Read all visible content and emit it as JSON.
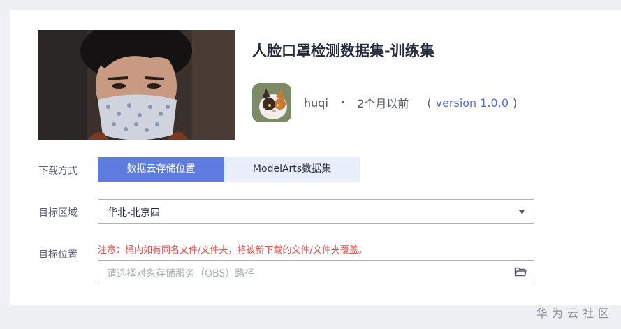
{
  "dataset": {
    "title": "人脸口罩检测数据集-训练集",
    "author": "huqi",
    "dot": "•",
    "time": "2个月以前",
    "version_open": "(",
    "version": "version 1.0.0",
    "version_close": ")"
  },
  "form": {
    "download_label": "下载方式",
    "tabs": [
      "数据云存储位置",
      "ModelArts数据集"
    ],
    "region_label": "目标区域",
    "region_value": "华北-北京四",
    "location_label": "目标位置",
    "warning": "注意：桶内如有同名文件/文件夹，将被新下载的文件/文件夹覆盖。",
    "path_placeholder": "请选择对象存储服务（OBS）路径"
  },
  "watermark": "华为云社区",
  "colors": {
    "primary": "#5e7ce0",
    "warning": "#de504e",
    "link": "#526ecc"
  },
  "icons": [
    "folder-icon",
    "chevron-down-icon"
  ]
}
